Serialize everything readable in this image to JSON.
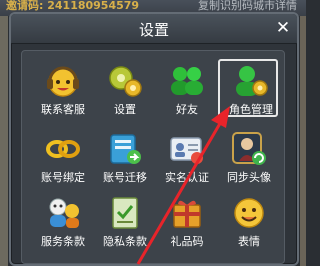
{
  "background": {
    "account_id_text": "邀请码: 241180954579",
    "copy_text": "复制识别码城市详情"
  },
  "dialog": {
    "title": "设置",
    "close_label": "✕"
  },
  "grid": {
    "items": [
      {
        "label": "联系客服",
        "icon": "customer-service-icon"
      },
      {
        "label": "设置",
        "icon": "settings-gear-icon"
      },
      {
        "label": "好友",
        "icon": "friends-icon"
      },
      {
        "label": "角色管理",
        "icon": "role-management-icon",
        "highlighted": true
      },
      {
        "label": "账号绑定",
        "icon": "account-bind-icon"
      },
      {
        "label": "账号迁移",
        "icon": "account-migrate-icon"
      },
      {
        "label": "实名认证",
        "icon": "realname-auth-icon"
      },
      {
        "label": "同步头像",
        "icon": "sync-avatar-icon"
      },
      {
        "label": "服务条款",
        "icon": "terms-of-service-icon"
      },
      {
        "label": "隐私条款",
        "icon": "privacy-terms-icon"
      },
      {
        "label": "礼品码",
        "icon": "gift-code-icon"
      },
      {
        "label": "表情",
        "icon": "emoticon-icon"
      }
    ]
  },
  "colors": {
    "annotation_arrow": "#e8242a",
    "highlight_border": "#e8e8e8",
    "panel": "#3d434a"
  }
}
